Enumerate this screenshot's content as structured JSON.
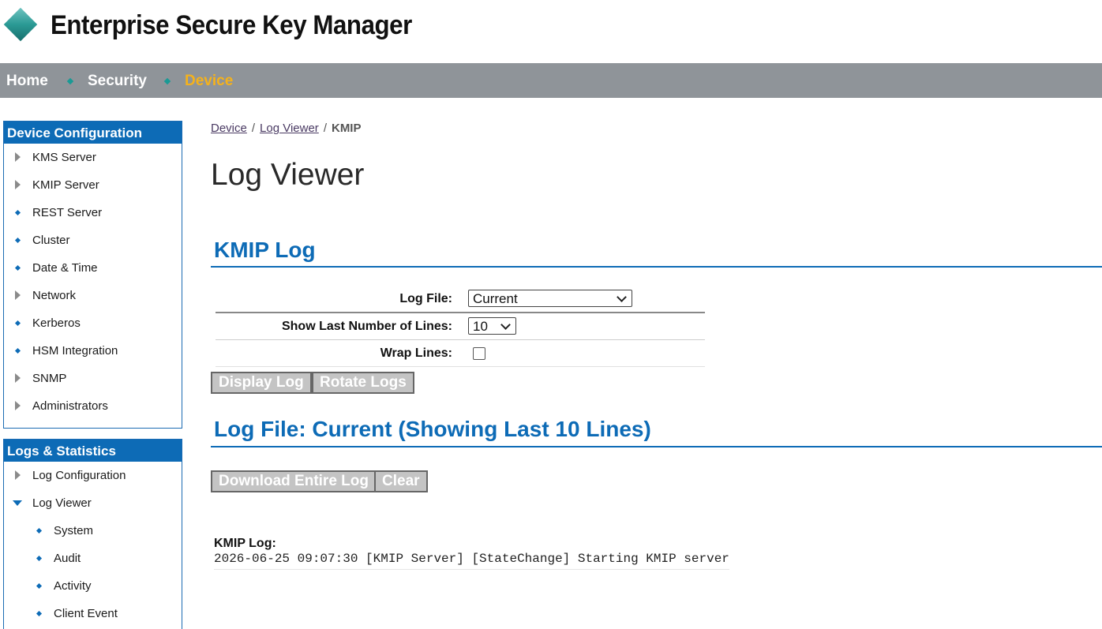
{
  "app": {
    "title": "Enterprise Secure Key Manager",
    "logo_icon": "diamond-logo-icon",
    "accent": "#0d6bb6",
    "active_nav_color": "#f5b21b"
  },
  "nav": {
    "items": [
      "Home",
      "Security",
      "Device"
    ],
    "active": "Device"
  },
  "sidebar": {
    "device_config": {
      "title": "Device Configuration",
      "items": [
        {
          "label": "KMS Server",
          "icon": "triangle-right-icon"
        },
        {
          "label": "KMIP Server",
          "icon": "triangle-right-icon"
        },
        {
          "label": "REST Server",
          "icon": "diamond-bullet-icon"
        },
        {
          "label": "Cluster",
          "icon": "diamond-bullet-icon"
        },
        {
          "label": "Date & Time",
          "icon": "diamond-bullet-icon"
        },
        {
          "label": "Network",
          "icon": "triangle-right-icon"
        },
        {
          "label": "Kerberos",
          "icon": "diamond-bullet-icon"
        },
        {
          "label": "HSM Integration",
          "icon": "diamond-bullet-icon"
        },
        {
          "label": "SNMP",
          "icon": "triangle-right-icon"
        },
        {
          "label": "Administrators",
          "icon": "triangle-right-icon"
        }
      ]
    },
    "logs_stats": {
      "title": "Logs & Statistics",
      "items": [
        {
          "label": "Log Configuration",
          "icon": "triangle-right-icon"
        },
        {
          "label": "Log Viewer",
          "icon": "triangle-down-icon"
        },
        {
          "label": "System",
          "icon": "diamond-bullet-icon"
        },
        {
          "label": "Audit",
          "icon": "diamond-bullet-icon"
        },
        {
          "label": "Activity",
          "icon": "diamond-bullet-icon"
        },
        {
          "label": "Client Event",
          "icon": "diamond-bullet-icon"
        }
      ]
    }
  },
  "breadcrumb": {
    "items": [
      "Device",
      "Log Viewer"
    ],
    "current": "KMIP",
    "separator": "/"
  },
  "page": {
    "title": "Log Viewer"
  },
  "kmip_section": {
    "title": "KMIP Log",
    "log_file_label": "Log File:",
    "log_file_value": "Current",
    "lines_label": "Show Last Number of Lines:",
    "lines_value": "10",
    "wrap_label": "Wrap Lines:",
    "wrap_checked": false,
    "display_button": "Display Log",
    "rotate_button": "Rotate Logs"
  },
  "log_section": {
    "title": "Log File: Current (Showing Last 10 Lines)",
    "download_button": "Download Entire Log",
    "clear_button": "Clear",
    "log_label": "KMIP Log:",
    "lines": [
      "2026-06-25 09:07:30 [KMIP Server] [StateChange] Starting KMIP server"
    ]
  }
}
